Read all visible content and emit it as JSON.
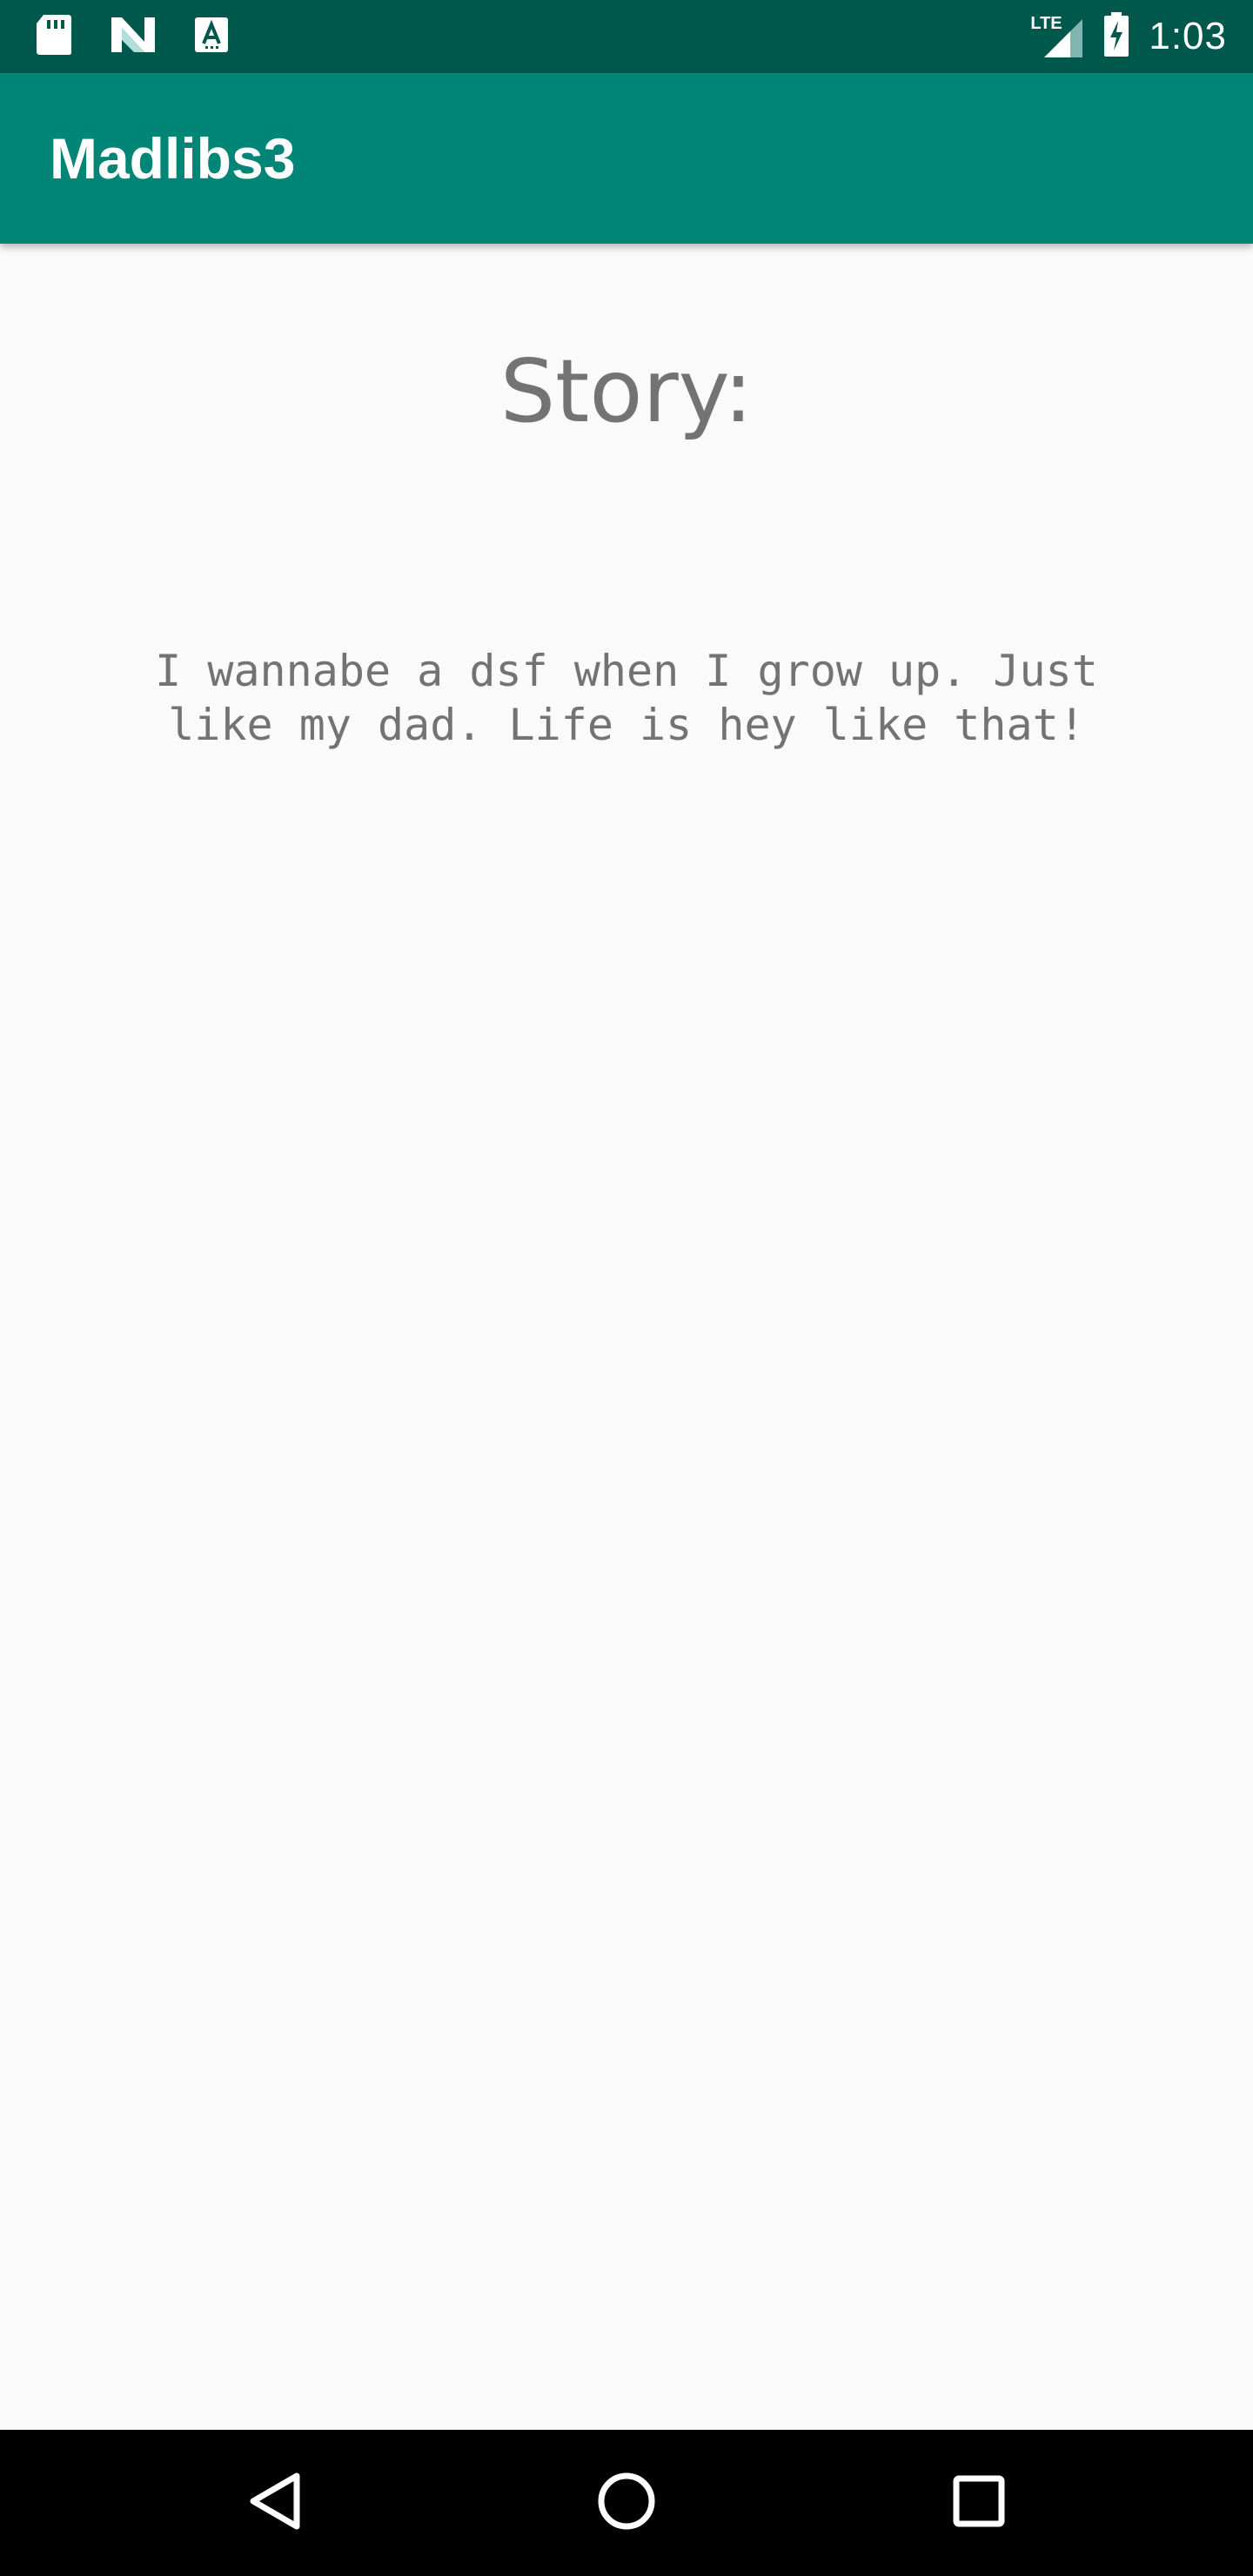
{
  "status_bar": {
    "time": "1:03",
    "network": "LTE",
    "left_icons": [
      "sd-card-icon",
      "n-notification-icon",
      "a-notification-icon"
    ],
    "right_icons": [
      "signal-icon",
      "battery-charging-icon"
    ]
  },
  "app_bar": {
    "title": "Madlibs3"
  },
  "story": {
    "heading": "Story:",
    "text": "I wannabe a dsf when I grow up. Just like my dad. Life is hey like that!"
  },
  "nav_bar": {
    "buttons": [
      "back-icon",
      "home-icon",
      "recents-icon"
    ]
  },
  "colors": {
    "status_bar": "#00574b",
    "app_bar": "#008577",
    "background": "#fafafa",
    "text_gray": "#737373",
    "nav_bar": "#000000"
  }
}
